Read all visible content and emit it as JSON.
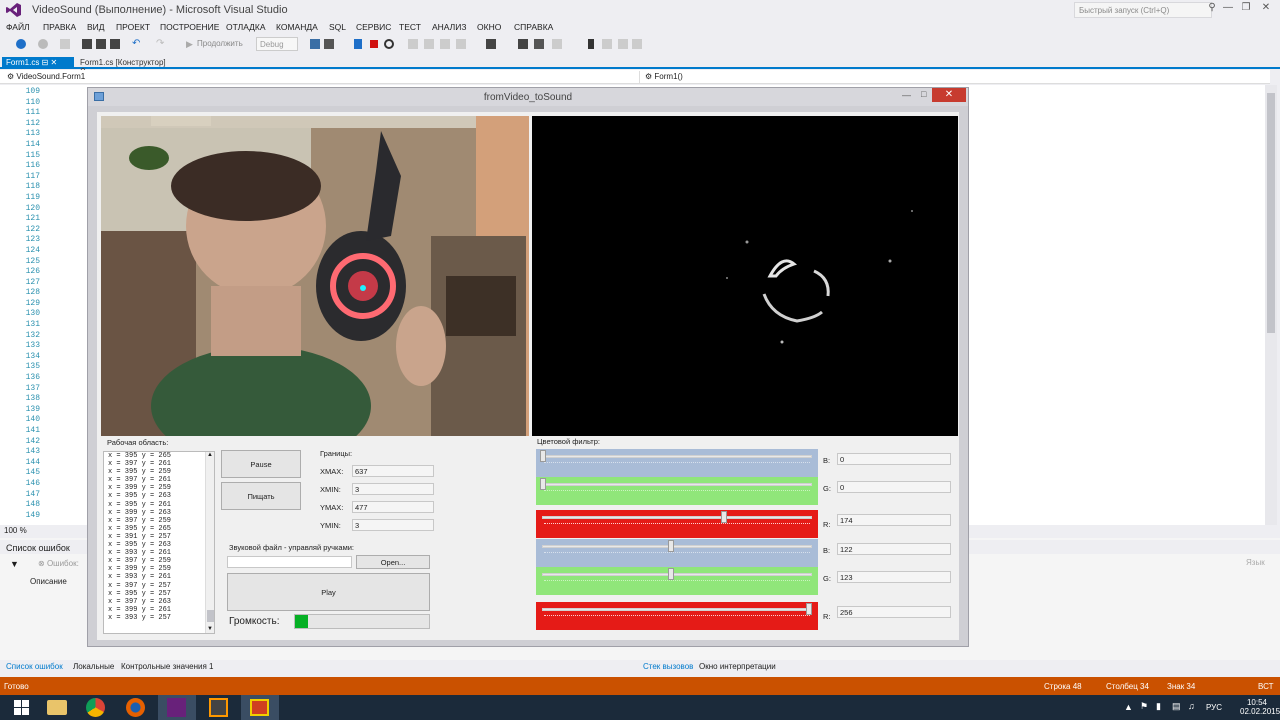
{
  "window": {
    "title": "VideoSound (Выполнение) - Microsoft Visual Studio",
    "quick_launch": "Быстрый запуск (Ctrl+Q)"
  },
  "menu": [
    "ФАЙЛ",
    "ПРАВКА",
    "ВИД",
    "ПРОЕКТ",
    "ПОСТРОЕНИЕ",
    "ОТЛАДКА",
    "КОМАНДА",
    "SQL",
    "СЕРВИС",
    "ТЕСТ",
    "АНАЛИЗ",
    "ОКНО",
    "СПРАВКА"
  ],
  "toolbar": {
    "continue": "Продолжить",
    "config": "Debug"
  },
  "tabs": [
    "Form1.cs",
    "Form1.cs [Конструктор]"
  ],
  "nav": {
    "left": "VideoSound.Form1",
    "right": "Form1()"
  },
  "line_numbers": [
    "109",
    "110",
    "111",
    "112",
    "113",
    "114",
    "115",
    "116",
    "117",
    "118",
    "119",
    "120",
    "121",
    "122",
    "123",
    "124",
    "125",
    "126",
    "127",
    "128",
    "129",
    "130",
    "131",
    "132",
    "133",
    "134",
    "135",
    "136",
    "137",
    "138",
    "139",
    "140",
    "141",
    "142",
    "143",
    "144",
    "145",
    "146",
    "147",
    "148",
    "149"
  ],
  "zoom": "100 %",
  "errorlist": {
    "title": "Список ошибок",
    "errors": "Ошибок:",
    "column": "Описание",
    "right": "Язык"
  },
  "bottom_tabs": {
    "errors": "Список ошибок",
    "locals": "Локальные",
    "watch": "Контрольные значения 1",
    "callstack": "Стек вызовов",
    "immediate": "Окно интерпретации"
  },
  "status": {
    "ready": "Готово",
    "line": "Строка 48",
    "col": "Столбец 34",
    "ch": "Знак 34",
    "ins": "ВСТ"
  },
  "taskbar": {
    "lang": "РУС",
    "time": "10:54",
    "date": "02.02.2015"
  },
  "form": {
    "title": "fromVideo_toSound",
    "workarea_label": "Рабочая область:",
    "list_rows": [
      "x = 395 y = 265",
      "x = 397 y = 261",
      "x = 395 y = 259",
      "x = 397 y = 261",
      "x = 399 y = 259",
      "x = 395 y = 263",
      "x = 395 y = 261",
      "x = 399 y = 263",
      "x = 397 y = 259",
      "x = 395 y = 265",
      "x = 391 y = 257",
      "x = 395 y = 263",
      "x = 393 y = 261",
      "x = 397 y = 259",
      "x = 399 y = 259",
      "x = 393 y = 261",
      "x = 397 y = 257",
      "x = 395 y = 257",
      "x = 397 y = 263",
      "x = 399 y = 261",
      "x = 393 y = 257"
    ],
    "pause_label": "Pause",
    "beep_label": "Пищать",
    "bounds_label": "Границы:",
    "xmax_label": "XMAX:",
    "xmax": "637",
    "xmin_label": "XMIN:",
    "xmin": "3",
    "ymax_label": "YMAX:",
    "ymax": "477",
    "ymin_label": "YMIN:",
    "ymin": "3",
    "sound_label": "Звуковой файл - управляй ручками:",
    "open_label": "Open...",
    "play_label": "Play",
    "volume_label": "Громкость:",
    "volume_level": 0.1,
    "filter_label": "Цветовой фильтр:",
    "sliders": [
      {
        "channel": "B:",
        "value": "0",
        "color": "#a9bcd7",
        "pos": 0.0
      },
      {
        "channel": "G:",
        "value": "0",
        "color": "#90e67a",
        "pos": 0.0
      },
      {
        "channel": "R:",
        "value": "174",
        "color": "#e51b17",
        "pos": 0.68
      },
      {
        "channel": "B:",
        "value": "122",
        "color": "#a9bcd7",
        "pos": 0.48
      },
      {
        "channel": "G:",
        "value": "123",
        "color": "#90e67a",
        "pos": 0.48
      },
      {
        "channel": "R:",
        "value": "256",
        "color": "#e51b17",
        "pos": 1.0
      }
    ]
  }
}
